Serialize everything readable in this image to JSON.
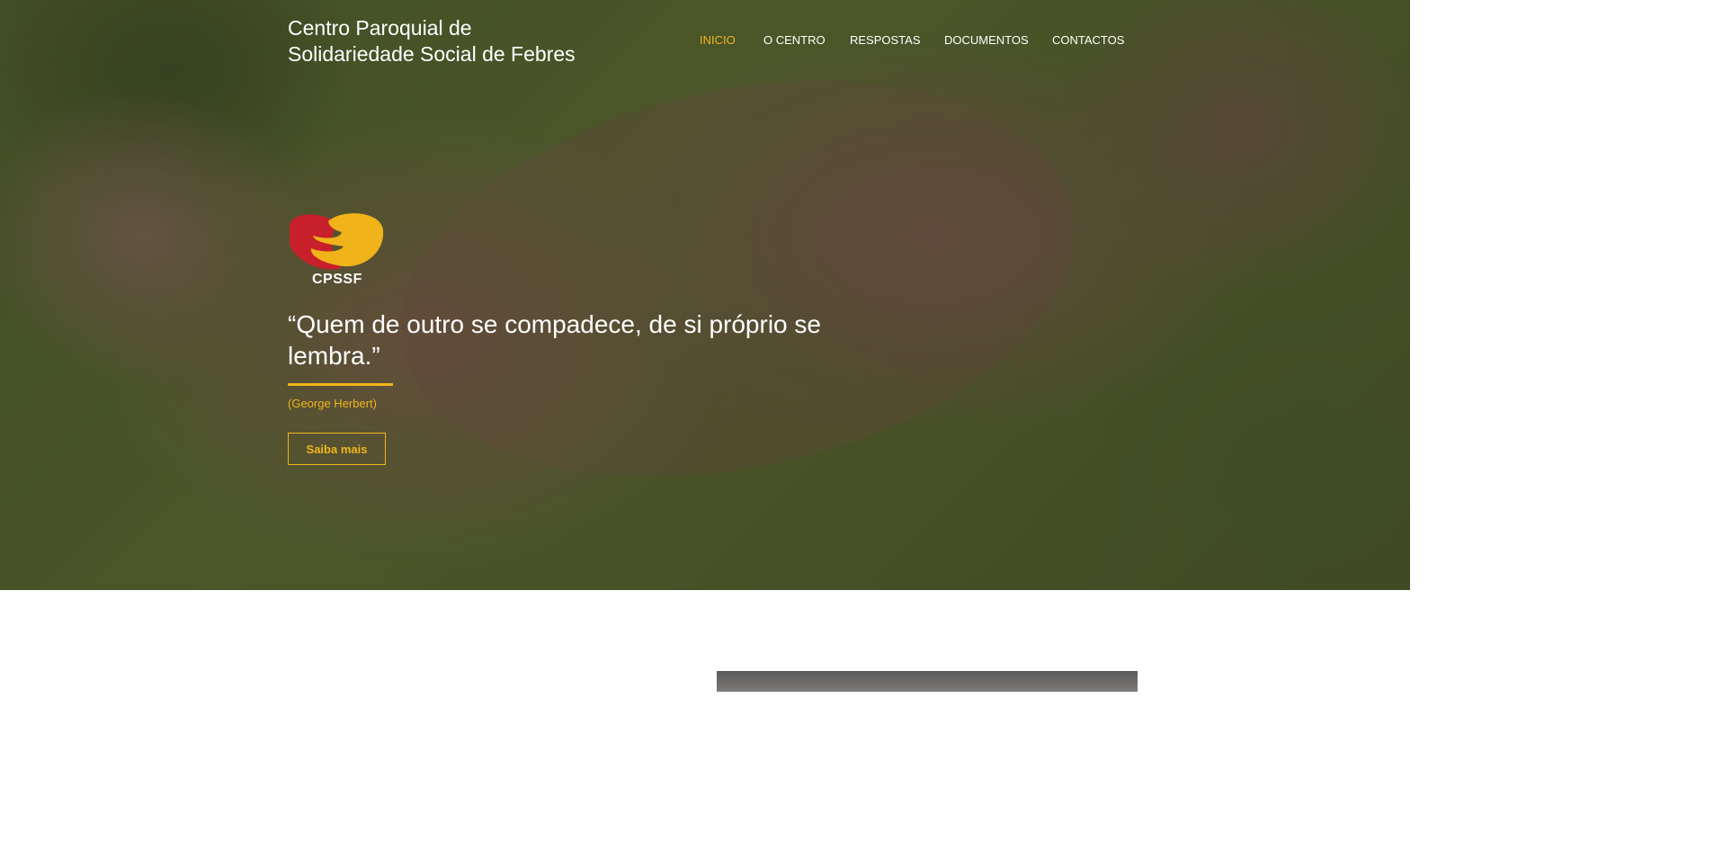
{
  "header": {
    "brand_line1": "Centro Paroquial de",
    "brand_line2": "Solidariedade Social de Febres"
  },
  "nav": {
    "items": [
      {
        "label": "INICIO",
        "active": true
      },
      {
        "label": "O CENTRO",
        "active": false
      },
      {
        "label": "RESPOSTAS",
        "active": false
      },
      {
        "label": "DOCUMENTOS",
        "active": false
      },
      {
        "label": "CONTACTOS",
        "active": false
      }
    ]
  },
  "hero": {
    "logo_text": "CPSSF",
    "quote": "“Quem de outro se compadece, de si próprio se lembra.”",
    "author": "(George Herbert)",
    "cta_label": "Saiba mais"
  },
  "colors": {
    "accent": "#f1b51c",
    "logo_red": "#c8202a",
    "logo_yellow": "#f0b31a",
    "text": "#ffffff"
  }
}
